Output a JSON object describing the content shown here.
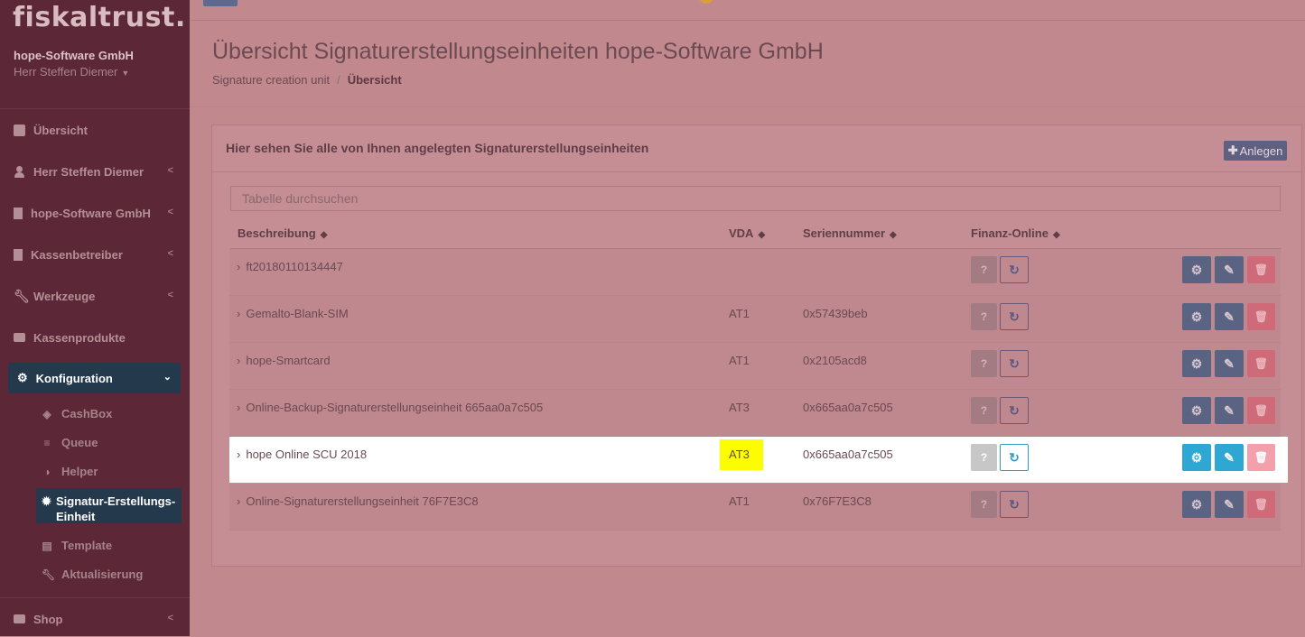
{
  "sidebar": {
    "logo": "fiskaltrust.",
    "company": "hope-Software GmbH",
    "user": "Herr Steffen Diemer",
    "nav": [
      {
        "label": "Übersicht",
        "icon": "dashboard-icon"
      },
      {
        "label": "Herr Steffen Diemer",
        "icon": "user-icon"
      },
      {
        "label": "hope-Software GmbH",
        "icon": "building-icon"
      },
      {
        "label": "Kassenbetreiber",
        "icon": "building-icon"
      },
      {
        "label": "Werkzeuge",
        "icon": "wrench-icon"
      },
      {
        "label": "Kassenprodukte",
        "icon": "briefcase-icon"
      },
      {
        "label": "Konfiguration",
        "icon": "cogs-icon"
      },
      {
        "label": "Shop",
        "icon": "basket-icon"
      }
    ],
    "sub": [
      {
        "label": "CashBox",
        "icon": "cube-icon"
      },
      {
        "label": "Queue",
        "icon": "database-icon"
      },
      {
        "label": "Helper",
        "icon": "half-circle-icon"
      },
      {
        "label": "Signatur-Erstellungs-Einheit",
        "icon": "certificate-icon"
      },
      {
        "label": "Template",
        "icon": "file-icon"
      },
      {
        "label": "Aktualisierung",
        "icon": "wrench-icon"
      }
    ]
  },
  "header": {
    "title": "Übersicht Signaturerstellungseinheiten hope-Software GmbH",
    "breadcrumb": [
      "Signature creation unit",
      "Übersicht"
    ]
  },
  "panel": {
    "title": "Hier sehen Sie alle von Ihnen angelegten Signaturerstellungseinheiten",
    "add_label": "Anlegen",
    "search_placeholder": "Tabelle durchsuchen",
    "columns": [
      "Beschreibung",
      "VDA",
      "Seriennummer",
      "Finanz-Online"
    ],
    "rows": [
      {
        "description": "ft20180110134447",
        "vda": "",
        "serial": ""
      },
      {
        "description": "Gemalto-Blank-SIM",
        "vda": "AT1",
        "serial": "0x57439beb"
      },
      {
        "description": "hope-Smartcard",
        "vda": "AT1",
        "serial": "0x2105acd8"
      },
      {
        "description": "Online-Backup-Signaturerstellungseinheit 665aa0a7c505",
        "vda": "AT3",
        "serial": "0x665aa0a7c505"
      },
      {
        "description": "hope Online SCU 2018",
        "vda": "AT3",
        "serial": "0x665aa0a7c505"
      },
      {
        "description": "Online-Signaturerstellungseinheit 76F7E3C8",
        "vda": "AT1",
        "serial": "0x76F7E3C8"
      }
    ],
    "highlighted_row": 4
  },
  "colors": {
    "sidebar_bg": "#5c2736",
    "active_nav": "#24394c",
    "overlay": "#c1898e",
    "highlight_yellow": "#fcfc02",
    "info_blue": "#2ea8d3",
    "danger": "#f2a0ac"
  }
}
